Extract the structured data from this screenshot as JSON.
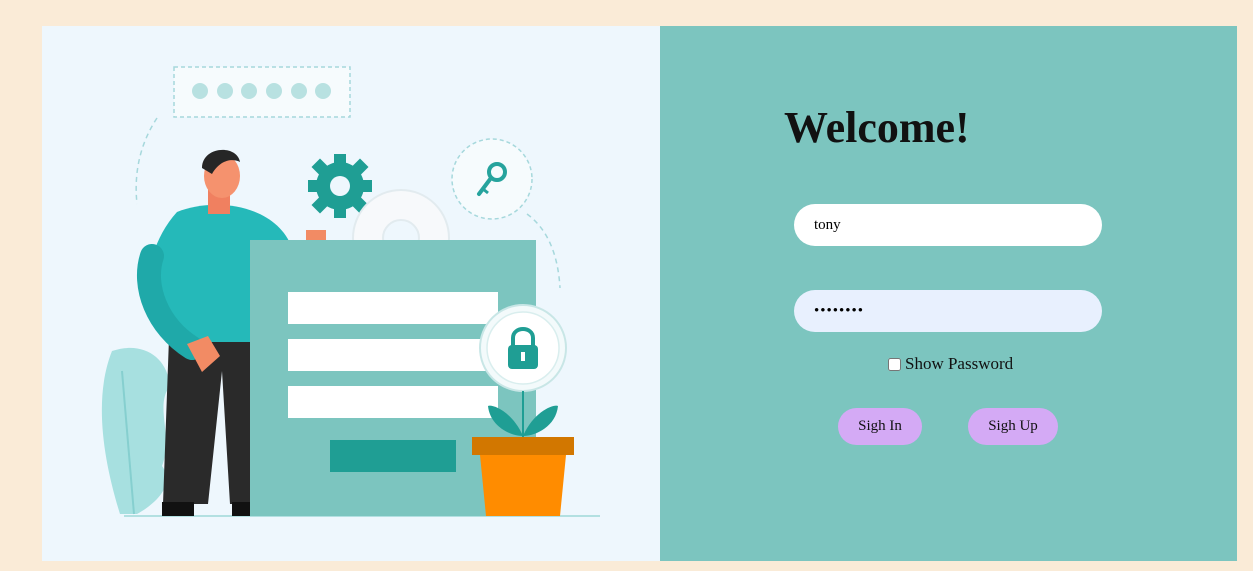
{
  "login": {
    "heading": "Welcome!",
    "username_value": "tony",
    "password_value": "12345678",
    "show_password_label": "Show Password",
    "signin_label": "Sigh In",
    "signup_label": "Sigh Up"
  },
  "colors": {
    "page_bg": "#faebd7",
    "left_panel_bg": "#eef7fd",
    "right_panel_bg": "#7cc5bf",
    "button_bg": "#d4aaf5",
    "teal": "#25b9b9",
    "orange": "#ff8c00"
  },
  "illustration": {
    "icons": [
      "password-dots-icon",
      "gear-icon",
      "key-icon",
      "padlock-icon",
      "plant-icon"
    ]
  }
}
